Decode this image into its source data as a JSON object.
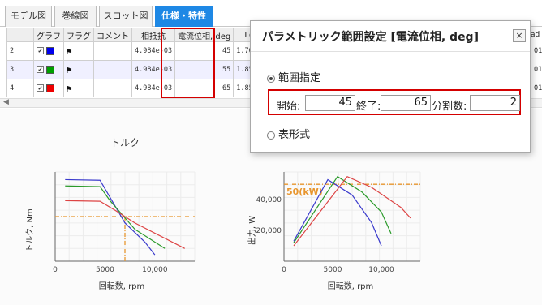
{
  "tabs": [
    "モデル図",
    "巻線図",
    "スロット図",
    "仕様・特性"
  ],
  "table": {
    "headers": [
      "",
      "グラフ",
      "フラグ",
      "コメント",
      "相抵抗",
      "電流位相, deg",
      "Ld, H",
      "",
      "",
      "",
      ""
    ],
    "rows": [
      {
        "id": "2",
        "resistance": "4.984e-03",
        "phase": "45",
        "ld": "1.700e-04",
        "color": "#0000ee"
      },
      {
        "id": "3",
        "resistance": "4.984e-03",
        "phase": "55",
        "ld": "1.859e-04",
        "color": "#00a000"
      },
      {
        "id": "4",
        "resistance": "4.984e-03",
        "phase": "65",
        "ld": "1.857e-04",
        "color": "#ee0000"
      }
    ],
    "right_header_fragment": "ad",
    "right_cell_fragments": [
      "01",
      "01",
      "01"
    ]
  },
  "dialog": {
    "title": "パラメトリック範囲設定 [電流位相, deg]",
    "close_label": "×",
    "range_option": "範囲指定",
    "start_label": "開始:",
    "start_value": "45",
    "end_label": "終了:",
    "end_value": "65",
    "div_label": "分割数:",
    "div_value": "2",
    "table_option": "表形式"
  },
  "chart_data": [
    {
      "type": "line",
      "title": "トルク",
      "xlabel": "回転数, rpm",
      "ylabel": "トルク, Nm",
      "xticks": [
        "0",
        "5000",
        "10,000"
      ],
      "xlim": [
        0,
        14000
      ],
      "ylim": [
        0,
        140
      ],
      "grid": true,
      "series": [
        {
          "color": "#3a3acc",
          "x": [
            1000,
            4500,
            7000,
            9000,
            10000
          ],
          "y": [
            128,
            127,
            60,
            30,
            10
          ]
        },
        {
          "color": "#2a9a2a",
          "x": [
            1000,
            4500,
            5500,
            8000,
            11000
          ],
          "y": [
            118,
            117,
            95,
            50,
            20
          ]
        },
        {
          "color": "#dd4444",
          "x": [
            1000,
            4500,
            6000,
            8000,
            13000
          ],
          "y": [
            95,
            94,
            80,
            60,
            20
          ]
        }
      ],
      "reference_lines": [
        {
          "type": "h",
          "value": 70,
          "color": "#e8962e"
        },
        {
          "type": "v",
          "value": 7000,
          "color": "#e8962e"
        }
      ]
    },
    {
      "type": "line",
      "xlabel": "出力, W",
      "x_title_fake": "",
      "ylabel": "出力, W",
      "x_axis_label": "回転数, rpm",
      "xticks": [
        "0",
        "5000",
        "10,000"
      ],
      "yticks": [
        "20,000",
        "40,000"
      ],
      "xlim": [
        0,
        14000
      ],
      "ylim": [
        0,
        58000
      ],
      "grid": true,
      "annotation": "50(kW)",
      "series": [
        {
          "color": "#3a3acc",
          "x": [
            1000,
            4500,
            7000,
            9000,
            10000
          ],
          "y": [
            13000,
            53000,
            43000,
            25000,
            10000
          ]
        },
        {
          "color": "#2a9a2a",
          "x": [
            1000,
            5500,
            8000,
            10000,
            11000
          ],
          "y": [
            12000,
            55000,
            45000,
            32000,
            18000
          ]
        },
        {
          "color": "#dd4444",
          "x": [
            1000,
            6500,
            9000,
            12000,
            13000
          ],
          "y": [
            10000,
            55000,
            48000,
            35000,
            28000
          ]
        }
      ],
      "reference_lines": [
        {
          "type": "h",
          "value": 50000,
          "color": "#e8962e"
        }
      ]
    }
  ]
}
